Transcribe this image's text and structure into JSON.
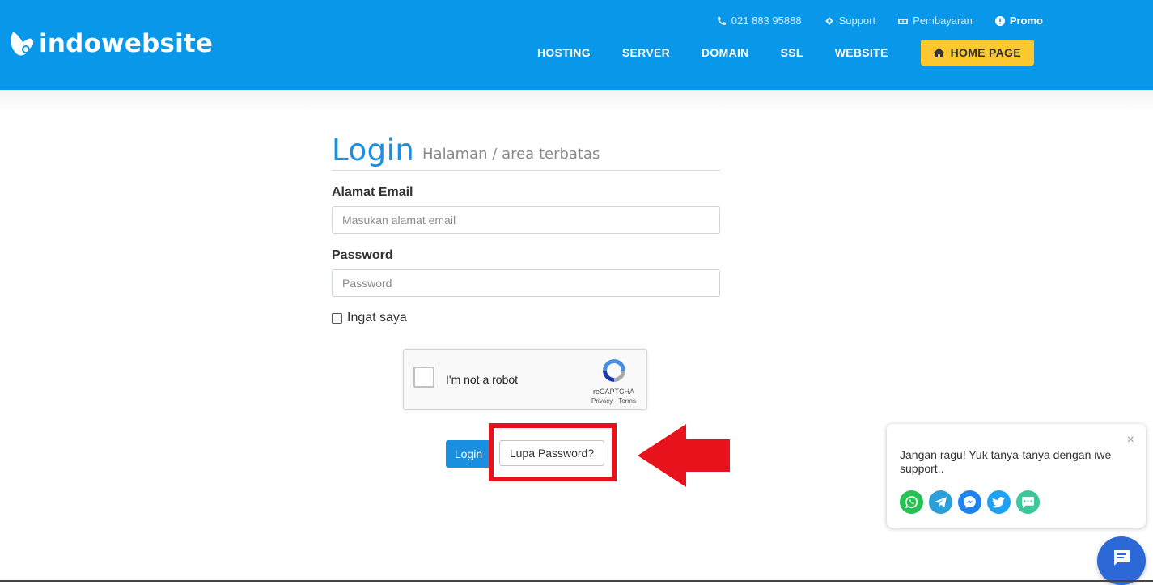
{
  "header": {
    "brand": "indowebsite",
    "topbar": {
      "phone": "021 883 95888",
      "support": "Support",
      "payment": "Pembayaran",
      "promo": "Promo"
    },
    "nav": [
      "HOSTING",
      "SERVER",
      "DOMAIN",
      "SSL",
      "WEBSITE"
    ],
    "home_button": "HOME PAGE"
  },
  "login": {
    "title": "Login",
    "subtitle": "Halaman / area terbatas",
    "email_label": "Alamat Email",
    "email_placeholder": "Masukan alamat email",
    "password_label": "Password",
    "password_placeholder": "Password",
    "remember_label": "Ingat saya",
    "recaptcha": {
      "text": "I'm not a robot",
      "brand": "reCAPTCHA",
      "terms": "Privacy - Terms"
    },
    "login_button": "Login",
    "forgot_button": "Lupa Password?"
  },
  "chat": {
    "message": "Jangan ragu! Yuk tanya-tanya dengan iwe support..",
    "close": "×",
    "channels": [
      "whatsapp-icon",
      "telegram-icon",
      "messenger-icon",
      "twitter-icon",
      "sms-icon"
    ]
  },
  "colors": {
    "header": "#0897e9",
    "accent": "#fdc72f",
    "primary": "#1a8fe0",
    "highlight": "#e8121c"
  }
}
